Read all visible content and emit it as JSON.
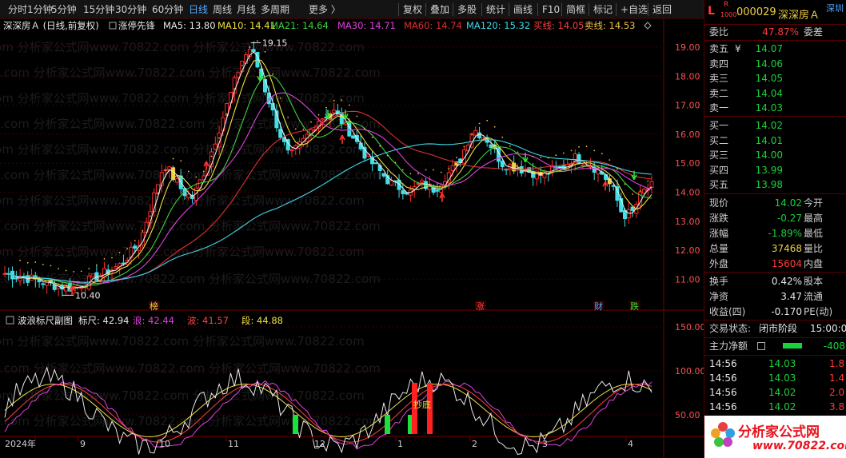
{
  "toolbar": {
    "periods": [
      "分时",
      "1分钟",
      "5分钟",
      "15分钟",
      "30分钟",
      "60分钟",
      "日线",
      "周线",
      "月线",
      "多周期",
      "更多 〉"
    ],
    "active": "日线",
    "tools": [
      "复权",
      "叠加",
      "多股",
      "统计",
      "画线",
      "F10",
      "简框",
      "标记",
      "+自选",
      "返回"
    ]
  },
  "main_chart": {
    "stock_title": "深深房Ａ (日线,前复权)",
    "indicator_name": "涨停先锋",
    "legend": [
      {
        "label": "MA5: 13.80",
        "color": "#e8e8e8"
      },
      {
        "label": "MA10: 14.41",
        "color": "#f0e040"
      },
      {
        "label": "MA21: 14.64",
        "color": "#3cd23c"
      },
      {
        "label": "MA30: 14.71",
        "color": "#e040e0"
      },
      {
        "label": "MA60: 14.74",
        "color": "#e03030"
      },
      {
        "label": "MA120: 15.32",
        "color": "#40d8e8"
      },
      {
        "label": "买线: 14.05",
        "color": "#ff4040"
      },
      {
        "label": "卖线: 14.53",
        "color": "#f0c040"
      }
    ],
    "high_label": "19.15",
    "low_label": "10.40",
    "y_ticks": [
      "19.00",
      "18.00",
      "17.00",
      "16.00",
      "15.00",
      "14.00",
      "13.00",
      "12.00",
      "11.00"
    ],
    "event_marks": [
      "榜",
      "涨",
      "财",
      "跌"
    ]
  },
  "sub_chart": {
    "title": "波浪标尺副图",
    "legend": [
      {
        "label": "标尺: 42.94",
        "color": "#e8e8e8"
      },
      {
        "label": "浪: 42.44",
        "color": "#e040e0"
      },
      {
        "label": "波: 41.57",
        "color": "#ff4040"
      },
      {
        "label": "段: 44.88",
        "color": "#f0e040"
      }
    ],
    "y_ticks": [
      "150.00",
      "100.00",
      "50.00"
    ],
    "annotation": "抄底"
  },
  "x_axis": [
    "2024年",
    "9",
    "10",
    "11",
    "12",
    "1",
    "2",
    "3",
    "4"
  ],
  "watermark": "分析家公式网www.70822.com",
  "panel": {
    "badge_L": "L",
    "badge_R": "R",
    "badge_num": "1000",
    "code": "000029",
    "name": "深深房Ａ",
    "market": "深圳",
    "weibi_label": "委比",
    "weibi_value": "47.87%",
    "weicha_label": "委差",
    "sells": [
      {
        "label": "卖五",
        "mark": "¥",
        "price": "14.07"
      },
      {
        "label": "卖四",
        "mark": "",
        "price": "14.06"
      },
      {
        "label": "卖三",
        "mark": "",
        "price": "14.05"
      },
      {
        "label": "卖二",
        "mark": "",
        "price": "14.04"
      },
      {
        "label": "卖一",
        "mark": "",
        "price": "14.03"
      }
    ],
    "buys": [
      {
        "label": "买一",
        "price": "14.02"
      },
      {
        "label": "买二",
        "price": "14.01"
      },
      {
        "label": "买三",
        "price": "14.00"
      },
      {
        "label": "买四",
        "price": "13.99"
      },
      {
        "label": "买五",
        "price": "13.98"
      }
    ],
    "quote": [
      {
        "label": "现价",
        "value": "14.02",
        "color": "g",
        "label2": "今开"
      },
      {
        "label": "涨跌",
        "value": "-0.27",
        "color": "g",
        "label2": "最高"
      },
      {
        "label": "涨幅",
        "value": "-1.89%",
        "color": "g",
        "label2": "最低"
      },
      {
        "label": "总量",
        "value": "37468",
        "color": "y",
        "label2": "量比"
      },
      {
        "label": "外盘",
        "value": "15604",
        "color": "r",
        "label2": "内盘"
      }
    ],
    "stats": [
      {
        "label": "换手",
        "value": "0.42%",
        "label2": "股本"
      },
      {
        "label": "净资",
        "value": "3.47",
        "label2": "流通"
      },
      {
        "label": "收益(四)",
        "value": "-0.170",
        "label2": "PE(动)"
      }
    ],
    "trade_status_label": "交易状态:",
    "trade_status_value": "闭市阶段",
    "trade_time": "15:00:0",
    "main_flow_label": "主力净额",
    "main_flow_value": "-408",
    "ticks": [
      {
        "time": "14:56",
        "price": "14.03",
        "vol": "1.8"
      },
      {
        "time": "14:56",
        "price": "14.03",
        "vol": "1.4"
      },
      {
        "time": "14:56",
        "price": "14.02",
        "vol": "2.0"
      },
      {
        "time": "14:56",
        "price": "14.02",
        "vol": "3.8"
      }
    ],
    "logo_text": "分析家公式网",
    "logo_url": "www.70822.com"
  }
}
